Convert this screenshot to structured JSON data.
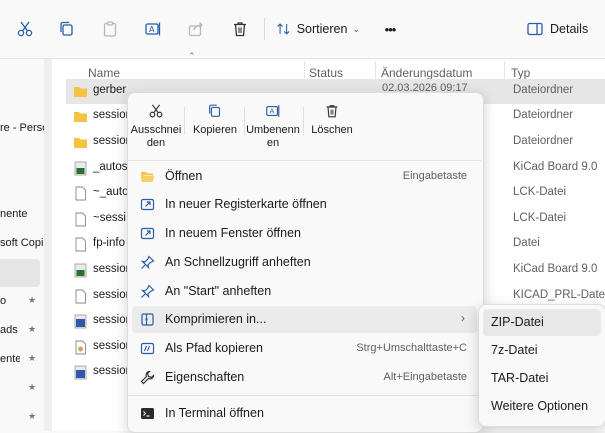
{
  "toolbar": {
    "sort_label": "Sortieren",
    "more_label": "•••",
    "details_label": "Details"
  },
  "nav": [
    {
      "label": "re - Perso"
    },
    {
      "label": "nente"
    },
    {
      "label": "soft Copi"
    },
    {
      "label": "o"
    },
    {
      "label": "ads"
    },
    {
      "label": "ente"
    }
  ],
  "columns": {
    "name": "Name",
    "status": "Status",
    "date": "Änderungsdatum",
    "type": "Typ"
  },
  "files": [
    {
      "name": "gerber",
      "date": "02.03.2026 09:17",
      "type": "Dateiordner",
      "icon": "folder"
    },
    {
      "name": "session",
      "type": "Dateiordner",
      "icon": "folder"
    },
    {
      "name": "session",
      "type": "Dateiordner",
      "icon": "folder"
    },
    {
      "name": "_autos",
      "type": "KiCad Board 9.0",
      "icon": "kicad-board"
    },
    {
      "name": "~_auto",
      "type": "LCK-Datei",
      "icon": "file"
    },
    {
      "name": "~sessi",
      "type": "LCK-Datei",
      "icon": "file"
    },
    {
      "name": "fp-info",
      "type": "Datei",
      "icon": "file"
    },
    {
      "name": "session",
      "type": "KiCad Board 9.0",
      "icon": "kicad-board"
    },
    {
      "name": "session",
      "type": "KICAD_PRL-Datei",
      "icon": "file"
    },
    {
      "name": "session",
      "type": "",
      "icon": "kicad-project"
    },
    {
      "name": "session",
      "type": "",
      "icon": "file"
    },
    {
      "name": "session",
      "type": "",
      "icon": "kicad-project"
    }
  ],
  "context_menu": {
    "quick_actions": [
      {
        "label": "Ausschneiden",
        "icon": "cut-icon"
      },
      {
        "label": "Kopieren",
        "icon": "copy-icon"
      },
      {
        "label": "Umbenennen",
        "icon": "rename-icon"
      },
      {
        "label": "Löschen",
        "icon": "delete-icon"
      }
    ],
    "items": [
      {
        "label": "Öffnen",
        "shortcut": "Eingabetaste",
        "icon": "folder-open-icon"
      },
      {
        "label": "In neuer Registerkarte öffnen",
        "shortcut": "",
        "icon": "new-tab-icon"
      },
      {
        "label": "In neuem Fenster öffnen",
        "shortcut": "",
        "icon": "new-window-icon"
      },
      {
        "label": "An Schnellzugriff anheften",
        "shortcut": "",
        "icon": "pin-icon"
      },
      {
        "label": "An \"Start\" anheften",
        "shortcut": "",
        "icon": "pin-icon"
      },
      {
        "label": "Komprimieren in...",
        "shortcut": "",
        "icon": "archive-icon"
      },
      {
        "label": "Als Pfad kopieren",
        "shortcut": "Strg+Umschalttaste+C",
        "icon": "copy-path-icon"
      },
      {
        "label": "Eigenschaften",
        "shortcut": "Alt+Eingabetaste",
        "icon": "wrench-icon"
      },
      {
        "label": "In Terminal öffnen",
        "shortcut": "",
        "icon": "terminal-icon"
      }
    ]
  },
  "submenu": {
    "items": [
      {
        "label": "ZIP-Datei"
      },
      {
        "label": "7z-Datei"
      },
      {
        "label": "TAR-Datei"
      },
      {
        "label": "Weitere Optionen"
      }
    ]
  },
  "colors": {
    "accent": "#0067c0",
    "folder": "#f5c242",
    "kicad": "#2a6f2e",
    "hover": "#ebebeb"
  }
}
